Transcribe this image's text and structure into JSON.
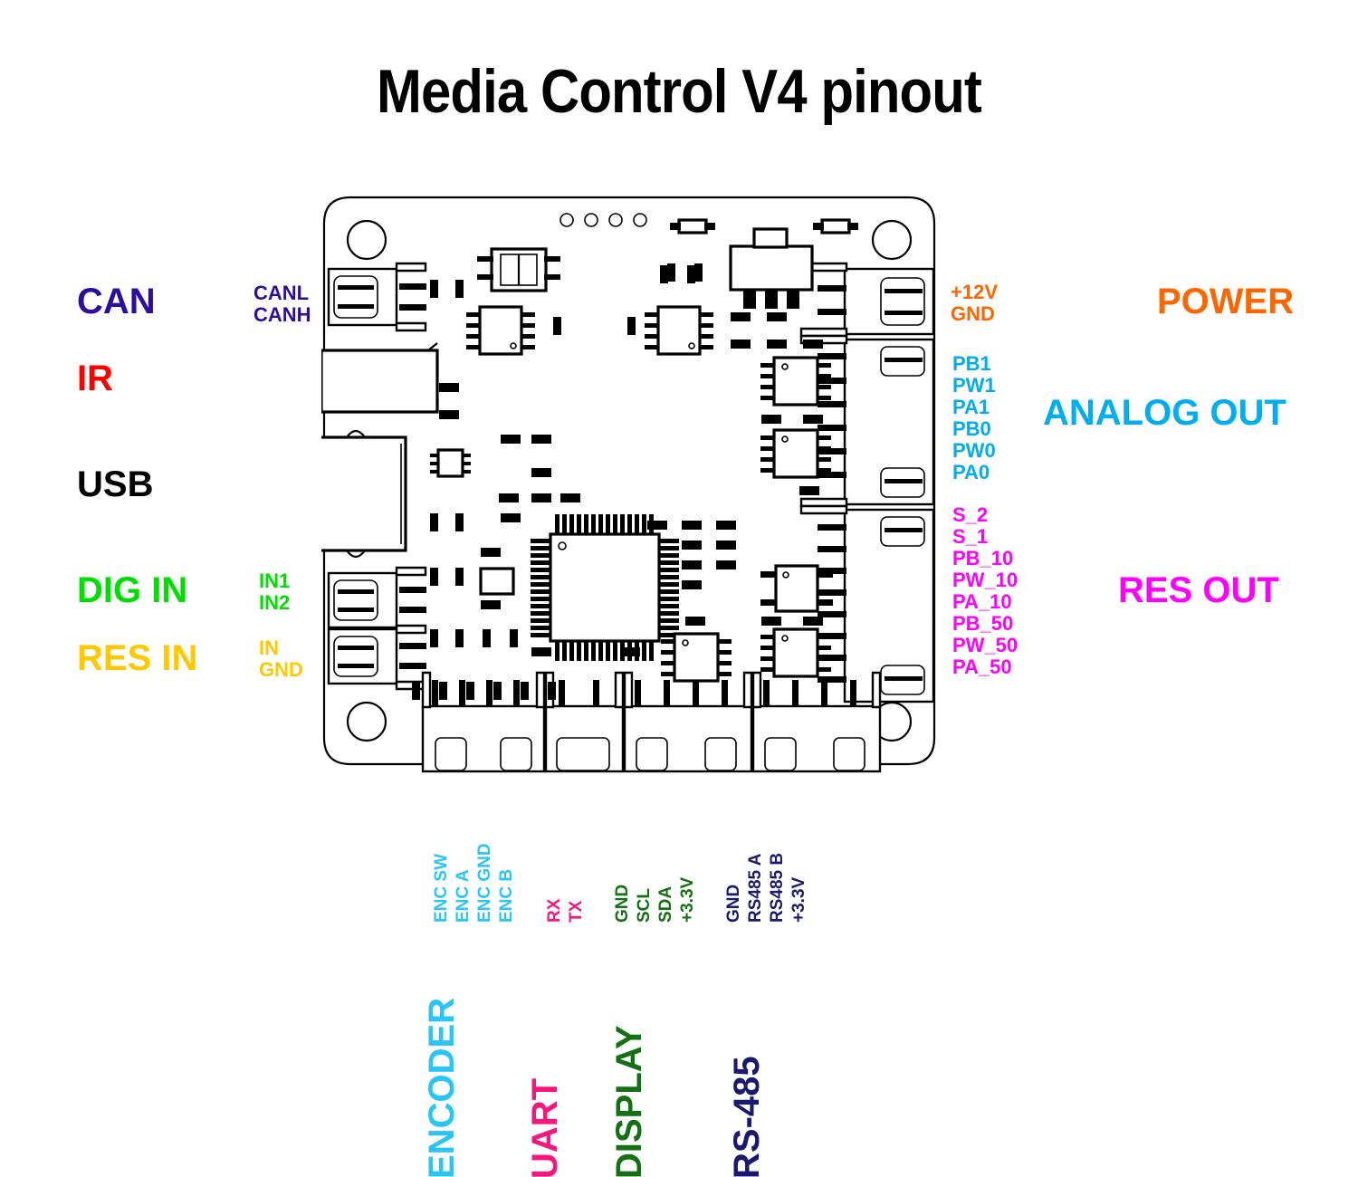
{
  "title": "Media Control V4 pinout",
  "left_groups": [
    {
      "name": "CAN",
      "color": "#2e0d9e",
      "pins": [
        "CANL",
        "CANH"
      ]
    },
    {
      "name": "IR",
      "color": "#ff0000",
      "pins": []
    },
    {
      "name": "USB",
      "color": "#000000",
      "pins": []
    },
    {
      "name": "DIG IN",
      "color": "#00dd00",
      "pins": [
        "IN1",
        "IN2"
      ]
    },
    {
      "name": "RES IN",
      "color": "#ffc800",
      "pins": [
        "IN",
        "GND"
      ]
    }
  ],
  "right_groups": [
    {
      "name": "POWER",
      "color": "#ff6600",
      "pins": [
        "+12V",
        "GND"
      ]
    },
    {
      "name": "ANALOG OUT",
      "color": "#00aeef",
      "pins": [
        "PB1",
        "PW1",
        "PA1",
        "PB0",
        "PW0",
        "PA0"
      ]
    },
    {
      "name": "RES OUT",
      "color": "#ff00ff",
      "pins": [
        "S_2",
        "S_1",
        "PB_10",
        "PW_10",
        "PA_10",
        "PB_50",
        "PW_50",
        "PA_50"
      ]
    }
  ],
  "bottom_groups": [
    {
      "name": "ENCODER",
      "color": "#29c5f6",
      "pins": [
        "ENC SW",
        "ENC A",
        "ENC GND",
        "ENC B"
      ]
    },
    {
      "name": "UART",
      "color": "#f5167e",
      "pins": [
        "RX",
        "TX"
      ]
    },
    {
      "name": "DISPLAY",
      "color": "#137013",
      "pins": [
        "GND",
        "SCL",
        "SDA",
        "+3.3V"
      ]
    },
    {
      "name": "RS-485",
      "color": "#191970",
      "pins": [
        "GND",
        "RS485 A",
        "RS485 B",
        "+3.3V"
      ]
    }
  ],
  "board": {
    "silkscreen_color": "#000000",
    "background_color": "#ffffff",
    "mounting_holes": 4,
    "mcu_package": "QFP",
    "regulator_package": "SOT-223"
  }
}
